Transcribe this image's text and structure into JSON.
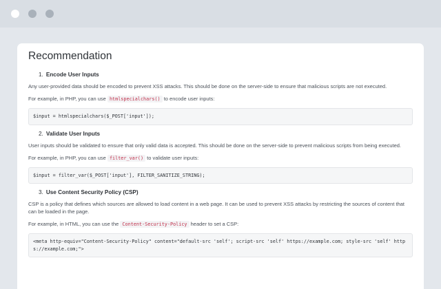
{
  "window": {
    "controls": [
      "close-dot",
      "minimize-dot",
      "maximize-dot"
    ]
  },
  "title": "Recommendation",
  "items": [
    {
      "num": "1.",
      "heading": "Encode User Inputs",
      "desc": "Any user-provided data should be encoded to prevent XSS attacks. This should be done on the server-side to ensure that malicious scripts are not executed.",
      "example_pre": "For example, in PHP, you can use",
      "example_code": "htmlspecialchars()",
      "example_post": "to encode user inputs:",
      "code": "$input = htmlspecialchars($_POST['input']);"
    },
    {
      "num": "2.",
      "heading": "Validate User Inputs",
      "desc": "User inputs should be validated to ensure that only valid data is accepted. This should be done on the server-side to prevent malicious scripts from being executed.",
      "example_pre": "For example, in PHP, you can use",
      "example_code": "filter_var()",
      "example_post": "to validate user inputs:",
      "code": "$input = filter_var($_POST['input'], FILTER_SANITIZE_STRING);"
    },
    {
      "num": "3.",
      "heading": "Use Content Security Policy (CSP)",
      "desc": "CSP is a policy that defines which sources are allowed to load content in a web page. It can be used to prevent XSS attacks by restricting the sources of content that can be loaded in the page.",
      "example_pre": "For example, in HTML, you can use the",
      "example_code": "Content-Security-Policy",
      "example_post": "header to set a CSP:",
      "code": "<meta http-equiv=\"Content-Security-Policy\" content=\"default-src 'self'; script-src 'self' https://example.com; style-src 'self' https://example.com;\">"
    }
  ]
}
